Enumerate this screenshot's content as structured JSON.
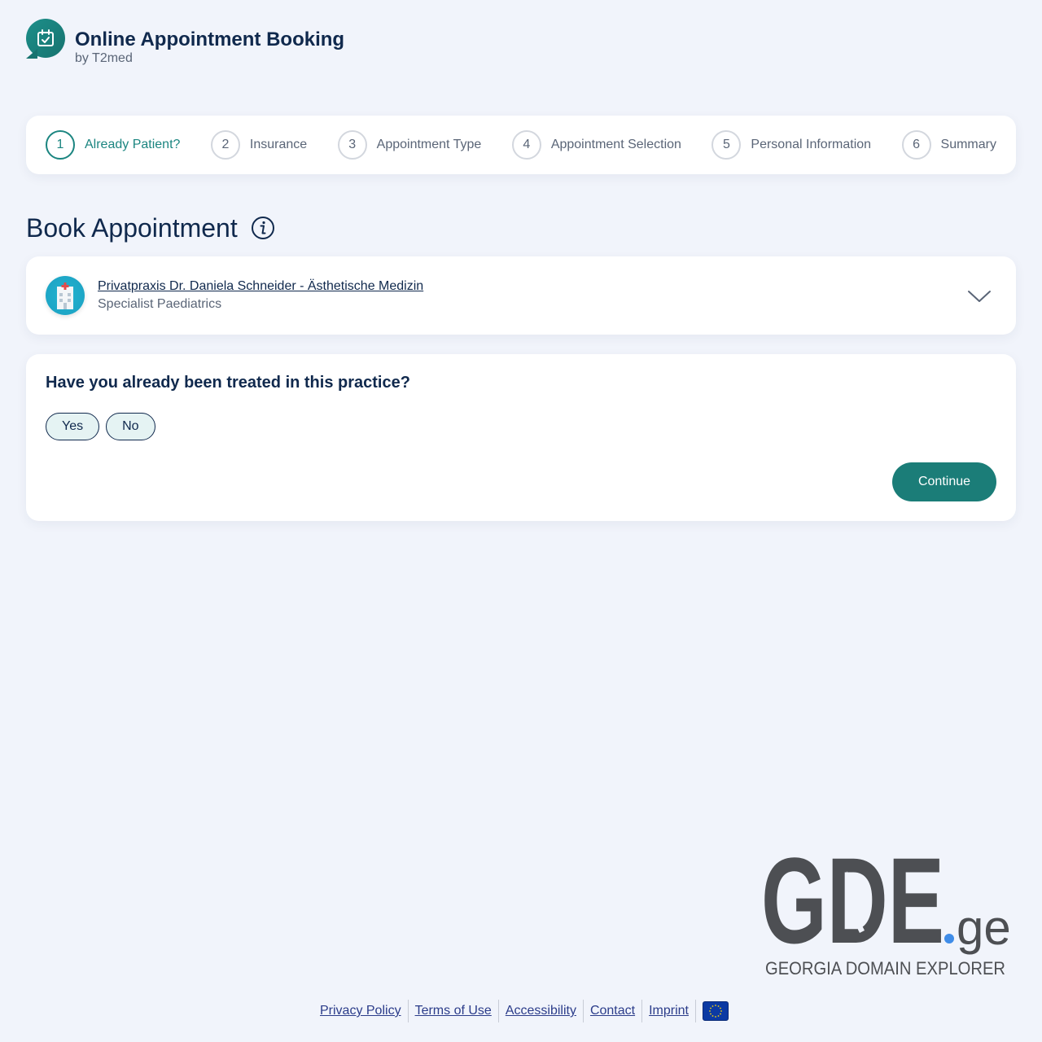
{
  "header": {
    "title": "Online Appointment Booking",
    "subtitle": "by T2med",
    "logo_icon": "calendar-check-icon"
  },
  "steps": [
    {
      "num": "1",
      "label": "Already Patient?",
      "active": true
    },
    {
      "num": "2",
      "label": "Insurance",
      "active": false
    },
    {
      "num": "3",
      "label": "Appointment Type",
      "active": false
    },
    {
      "num": "4",
      "label": "Appointment Selection",
      "active": false
    },
    {
      "num": "5",
      "label": "Personal Information",
      "active": false
    },
    {
      "num": "6",
      "label": "Summary",
      "active": false
    }
  ],
  "main": {
    "page_title": "Book Appointment",
    "info_icon": "info-icon"
  },
  "practice": {
    "name": "Privatpraxis Dr. Daniela Schneider - Ästhetische Medizin",
    "specialty": "Specialist Paediatrics",
    "icon": "hospital-icon"
  },
  "question": {
    "text": "Have you already been treated in this practice?",
    "yes_label": "Yes",
    "no_label": "No",
    "continue_label": "Continue"
  },
  "watermark": {
    "brand": "GDE",
    "tld": ".ge",
    "tagline": "GEORGIA DOMAIN EXPLORER"
  },
  "footer": {
    "links": [
      "Privacy Policy",
      "Terms of Use",
      "Accessibility",
      "Contact",
      "Imprint"
    ],
    "flag_icon": "eu-flag-icon"
  },
  "colors": {
    "background": "#f1f4fb",
    "accent": "#1b7d78",
    "text": "#10294d"
  }
}
